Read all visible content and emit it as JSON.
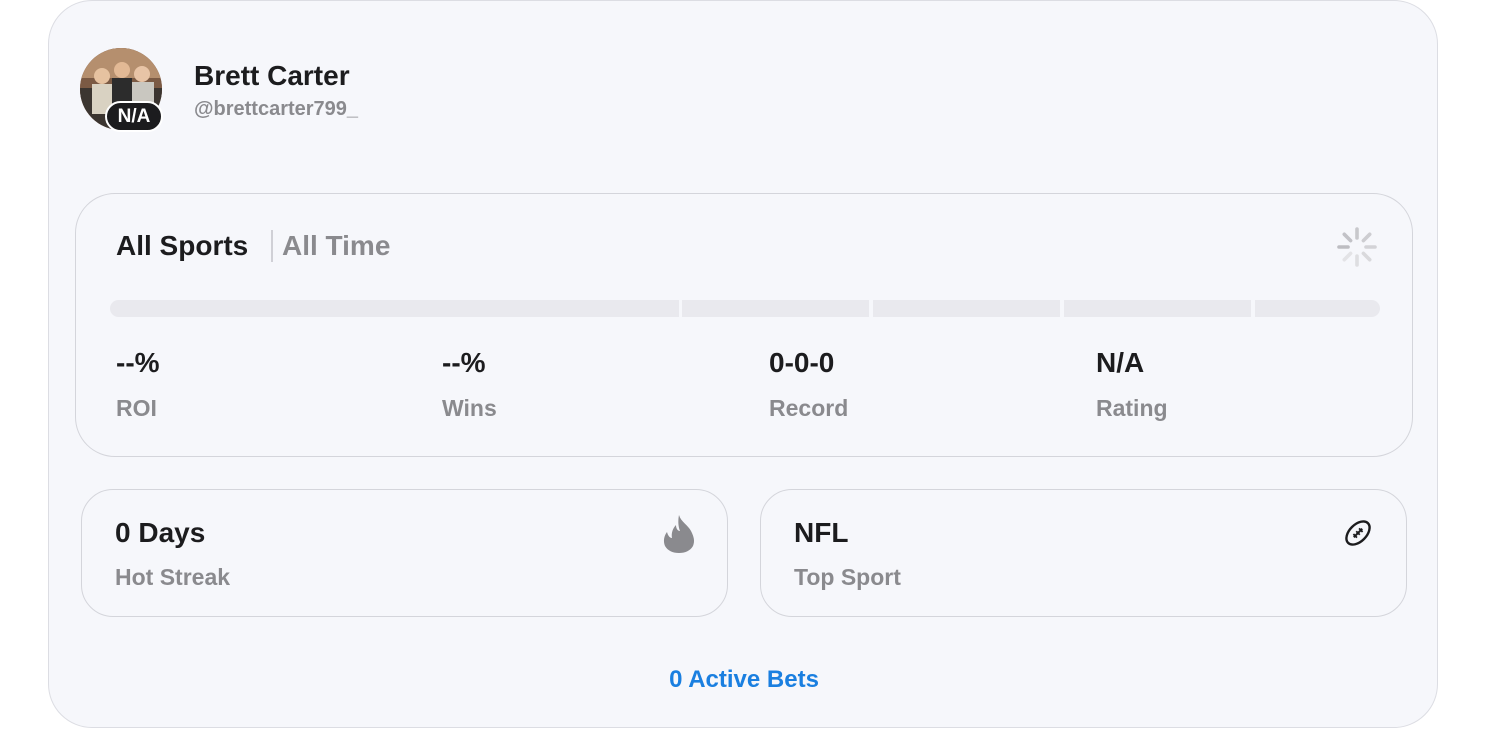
{
  "profile": {
    "name": "Brett Carter",
    "handle": "@brettcarter799_",
    "rank_badge": "N/A"
  },
  "stats": {
    "scope_label": "All Sports",
    "timeframe_label": "All Time",
    "loading_icon": "spinner-icon",
    "items": [
      {
        "value": "--%",
        "label": "ROI"
      },
      {
        "value": "--%",
        "label": "Wins"
      },
      {
        "value": "0-0-0",
        "label": "Record"
      },
      {
        "value": "N/A",
        "label": "Rating"
      }
    ]
  },
  "streak": {
    "value": "0 Days",
    "label": "Hot Streak",
    "icon": "flame-icon"
  },
  "top_sport": {
    "value": "NFL",
    "label": "Top Sport",
    "icon": "football-icon"
  },
  "active_bets": "0 Active Bets",
  "colors": {
    "accent": "#1a7fe0",
    "muted": "#8a8a8e",
    "text": "#1c1c1e",
    "panel": "#f6f7fb"
  }
}
